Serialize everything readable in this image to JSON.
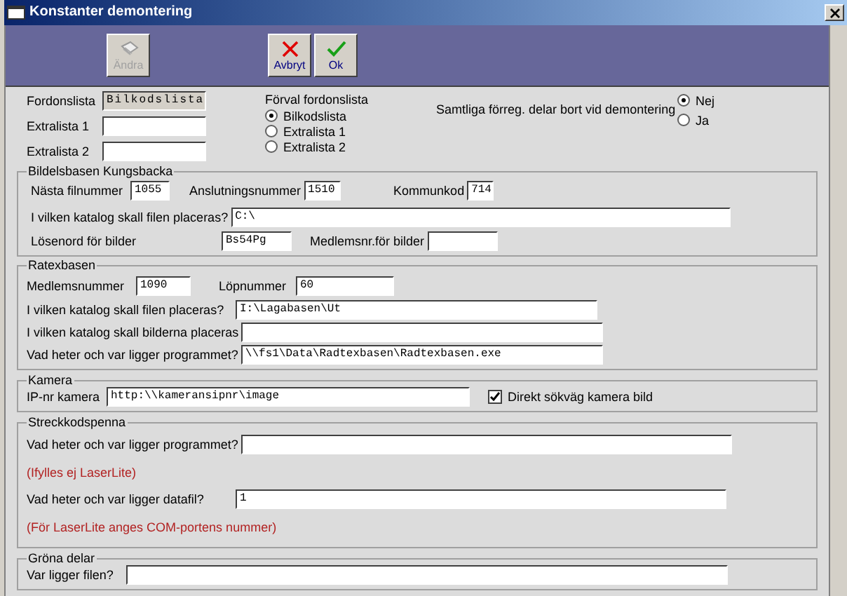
{
  "window": {
    "title": "Konstanter demontering"
  },
  "toolbar": {
    "buttons": [
      {
        "label": "Ändra",
        "kind": "edit",
        "disabled": true
      },
      {
        "label": "Avbryt",
        "kind": "cancel",
        "disabled": false
      },
      {
        "label": "Ok",
        "kind": "ok",
        "disabled": false
      }
    ]
  },
  "vehicle_lists": [
    {
      "label": "Fordonslista",
      "value": "Bilkodslista",
      "readonly": true
    },
    {
      "label": "Extralista 1",
      "readonly": false
    },
    {
      "label": "Extralista 2",
      "readonly": false
    }
  ],
  "default_list": {
    "label": "Förval fordonslista",
    "options": [
      {
        "label": "Bilkodslista",
        "selected": true
      },
      {
        "label": "Extralista 1",
        "selected": false
      },
      {
        "label": "Extralista 2",
        "selected": false
      }
    ]
  },
  "remove_all": {
    "label": "Samtliga förreg. delar bort vid demontering",
    "options": [
      {
        "label": "Nej",
        "selected": true
      },
      {
        "label": "Ja",
        "selected": false
      }
    ]
  },
  "bildelsbasen": {
    "title": "Bildelsbasen Kungsbacka",
    "next_file_number": {
      "label": "Nästa filnummer",
      "value": "1055"
    },
    "connection_number": {
      "label": "Anslutningsnummer",
      "value": "1510"
    },
    "municipality_code": {
      "label": "Kommunkod",
      "value": "714"
    },
    "file_folder": {
      "label": "I vilken katalog skall filen placeras?",
      "value": "C:\\"
    },
    "image_password": {
      "label": "Lösenord för bilder",
      "value": "Bs54Pg"
    },
    "image_member_number": {
      "label": "Medlemsnr.för bilder"
    }
  },
  "ratexbasen": {
    "title": "Ratexbasen",
    "member_number": {
      "label": "Medlemsnummer",
      "value": "1090"
    },
    "serial_number": {
      "label": "Löpnummer",
      "value": "60"
    },
    "file_folder": {
      "label": "I vilken katalog skall filen placeras?",
      "value": "I:\\Lagabasen\\Ut"
    },
    "image_folder": {
      "label": "I vilken katalog skall bilderna placeras"
    },
    "program": {
      "label": "Vad heter och var ligger programmet?",
      "value": "\\\\fs1\\Data\\Radtexbasen\\Radtexbasen.exe"
    }
  },
  "kamera": {
    "title": "Kamera",
    "ip": {
      "label": "IP-nr kamera",
      "value": "http:\\\\kameransipnr\\image"
    },
    "direct_path": {
      "label": "Direkt sökväg kamera bild",
      "checked": true
    }
  },
  "streckkodspenna": {
    "title": "Streckkodspenna",
    "program": {
      "label": "Vad heter och var ligger programmet?",
      "note": "(Ifylles ej LaserLite)"
    },
    "data_file": {
      "label": "Vad heter och var ligger datafil?",
      "value": "1",
      "note": "(För LaserLite anges COM-portens nummer)"
    }
  },
  "grona_delar": {
    "title": "Gröna delar",
    "file": {
      "label": "Var ligger filen?"
    }
  }
}
